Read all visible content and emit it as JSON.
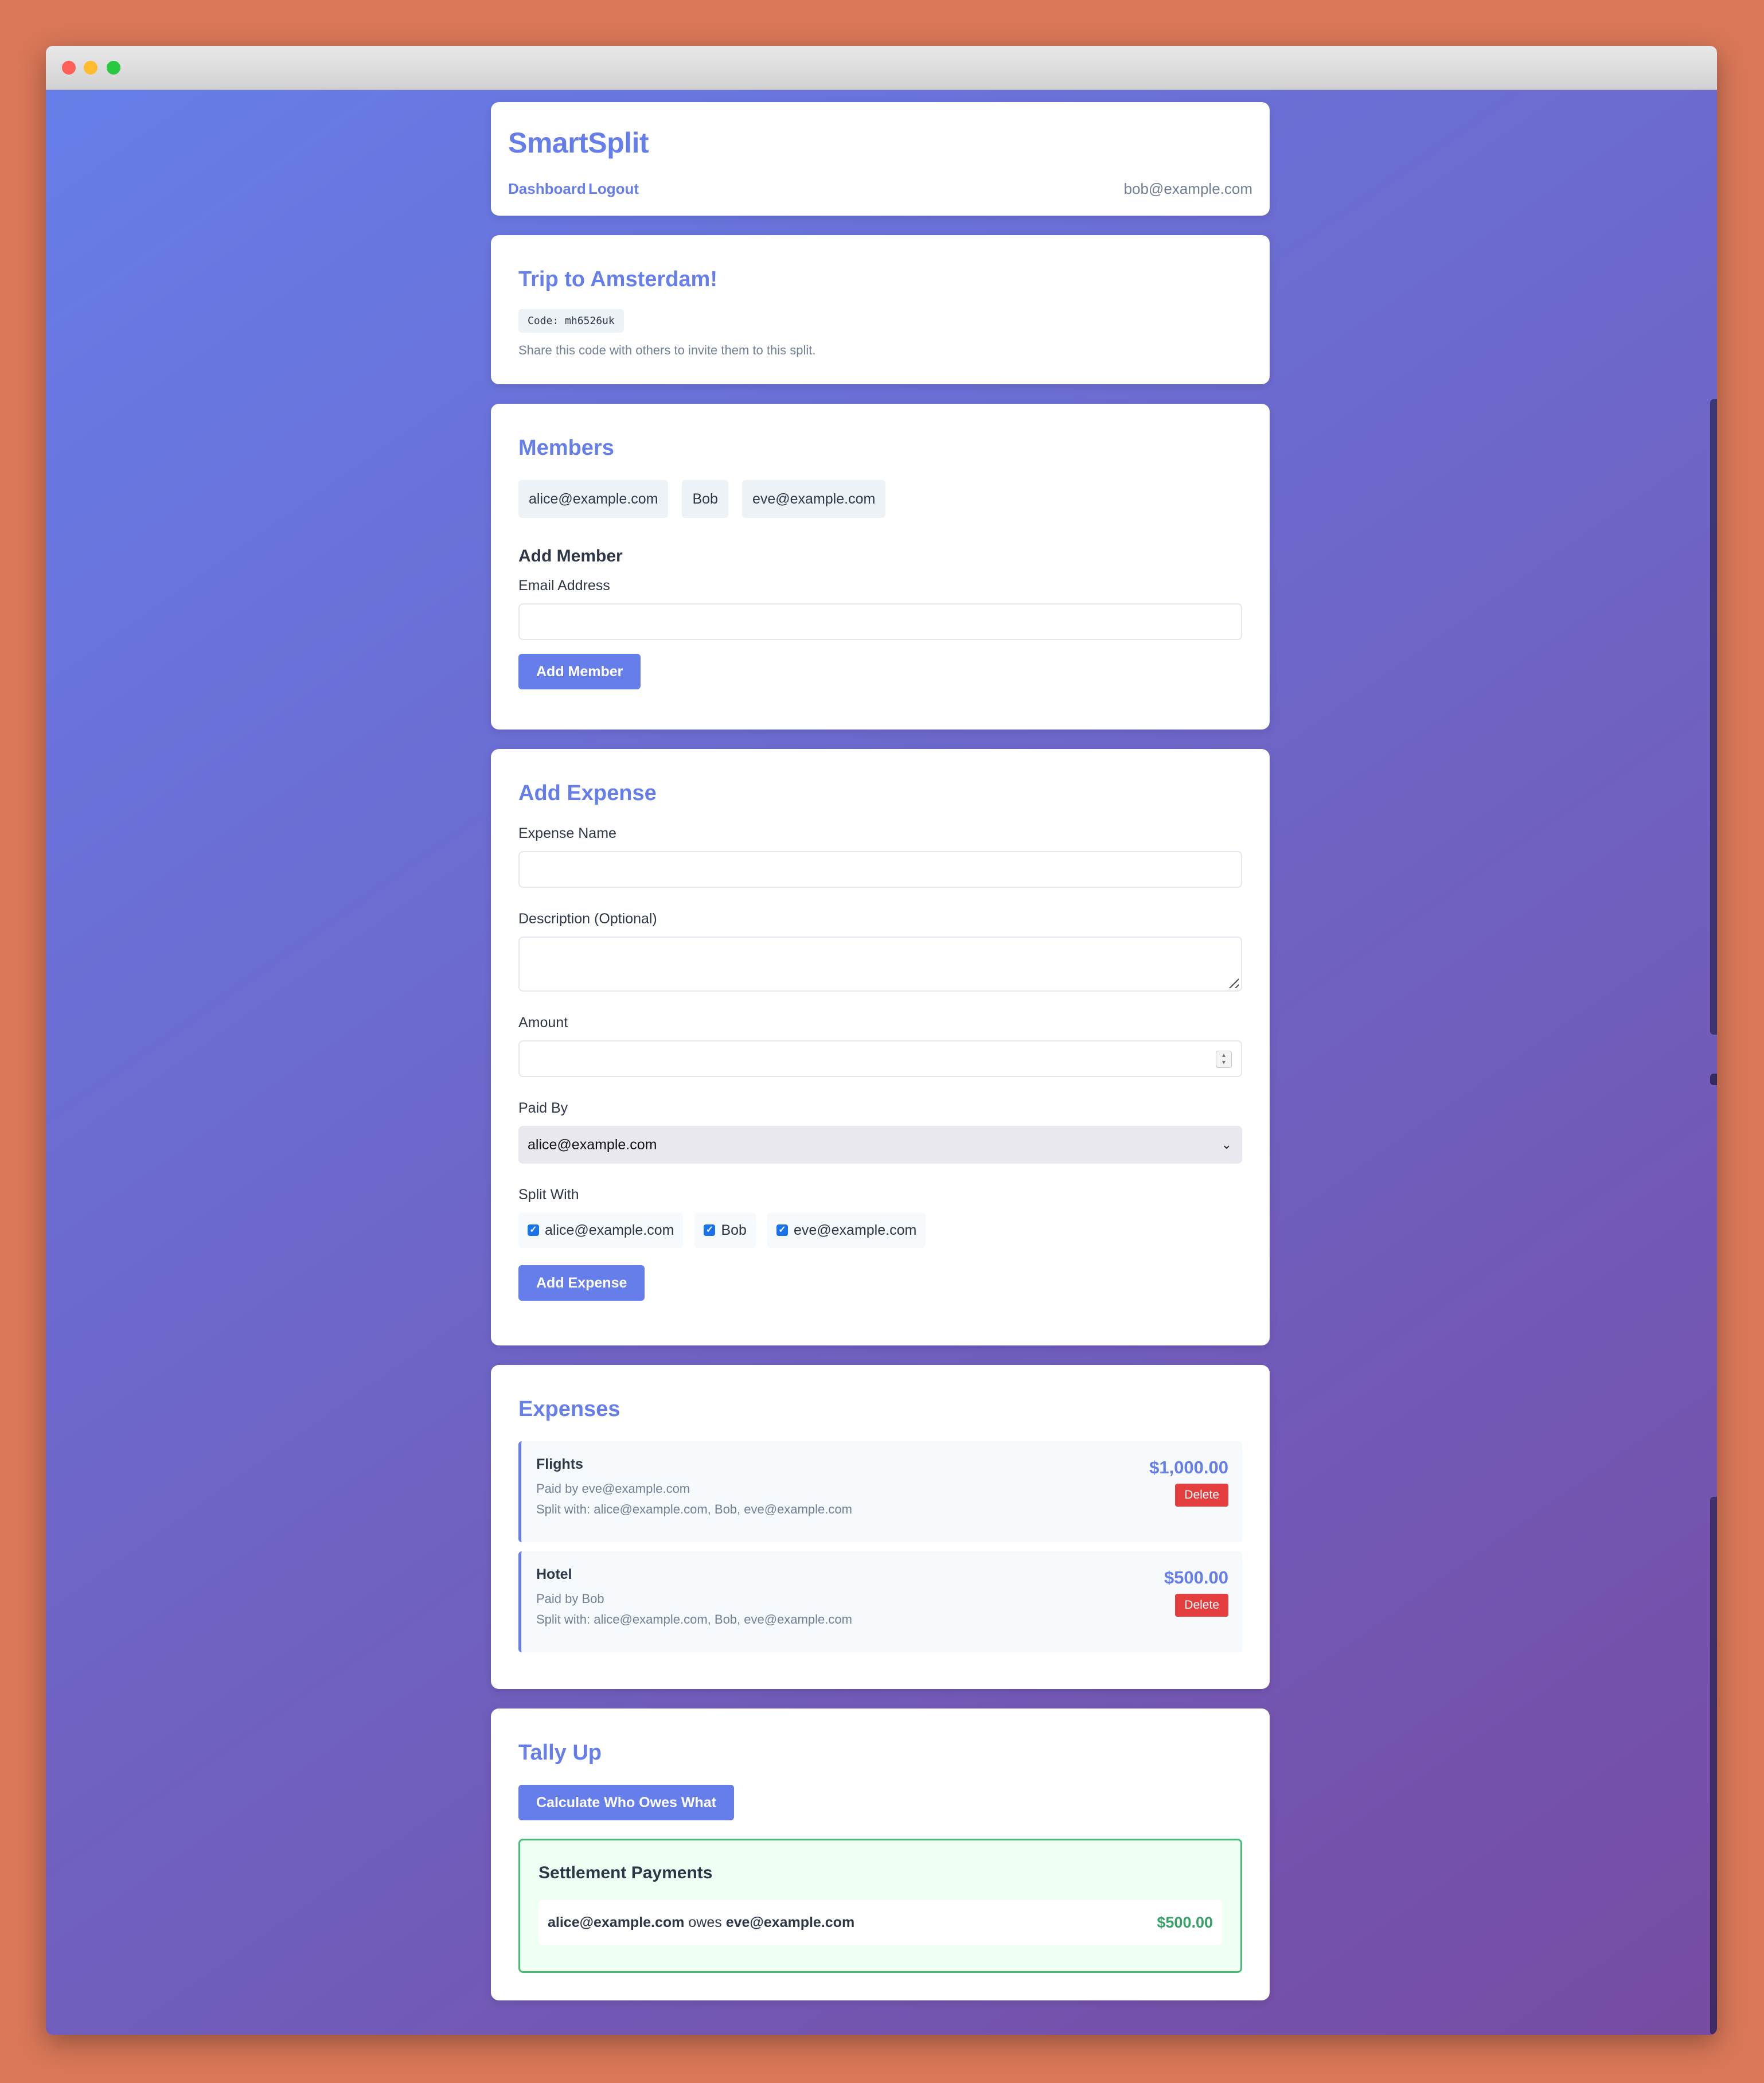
{
  "header": {
    "brand": "SmartSplit",
    "nav": [
      "Dashboard",
      "Logout"
    ],
    "user_email": "bob@example.com"
  },
  "split": {
    "title": "Trip to Amsterdam!",
    "code_label": "Code: mh6526uk",
    "share_hint": "Share this code with others to invite them to this split."
  },
  "members": {
    "title": "Members",
    "list": [
      "alice@example.com",
      "Bob",
      "eve@example.com"
    ],
    "add_heading": "Add Member",
    "email_label": "Email Address",
    "email_value": "",
    "add_button": "Add Member"
  },
  "add_expense": {
    "title": "Add Expense",
    "name_label": "Expense Name",
    "description_label": "Description (Optional)",
    "amount_label": "Amount",
    "paid_by_label": "Paid By",
    "paid_by_value": "alice@example.com",
    "split_with_label": "Split With",
    "split_with": [
      "alice@example.com",
      "Bob",
      "eve@example.com"
    ],
    "submit_button": "Add Expense"
  },
  "expenses": {
    "title": "Expenses",
    "items": [
      {
        "name": "Flights",
        "paid_by": "Paid by eve@example.com",
        "split_with": "Split with: alice@example.com, Bob, eve@example.com",
        "amount": "$1,000.00",
        "delete_label": "Delete"
      },
      {
        "name": "Hotel",
        "paid_by": "Paid by Bob",
        "split_with": "Split with: alice@example.com, Bob, eve@example.com",
        "amount": "$500.00",
        "delete_label": "Delete"
      }
    ]
  },
  "tally": {
    "title": "Tally Up",
    "calculate_button": "Calculate Who Owes What",
    "settlement_title": "Settlement Payments",
    "payments": [
      {
        "from": "alice@example.com",
        "verb": "owes",
        "to": "eve@example.com",
        "amount": "$500.00"
      }
    ]
  },
  "colors": {
    "accent": "#667eea",
    "danger": "#e53e3e",
    "success": "#38a169",
    "background_start": "#667eea",
    "background_end": "#764ba2"
  }
}
